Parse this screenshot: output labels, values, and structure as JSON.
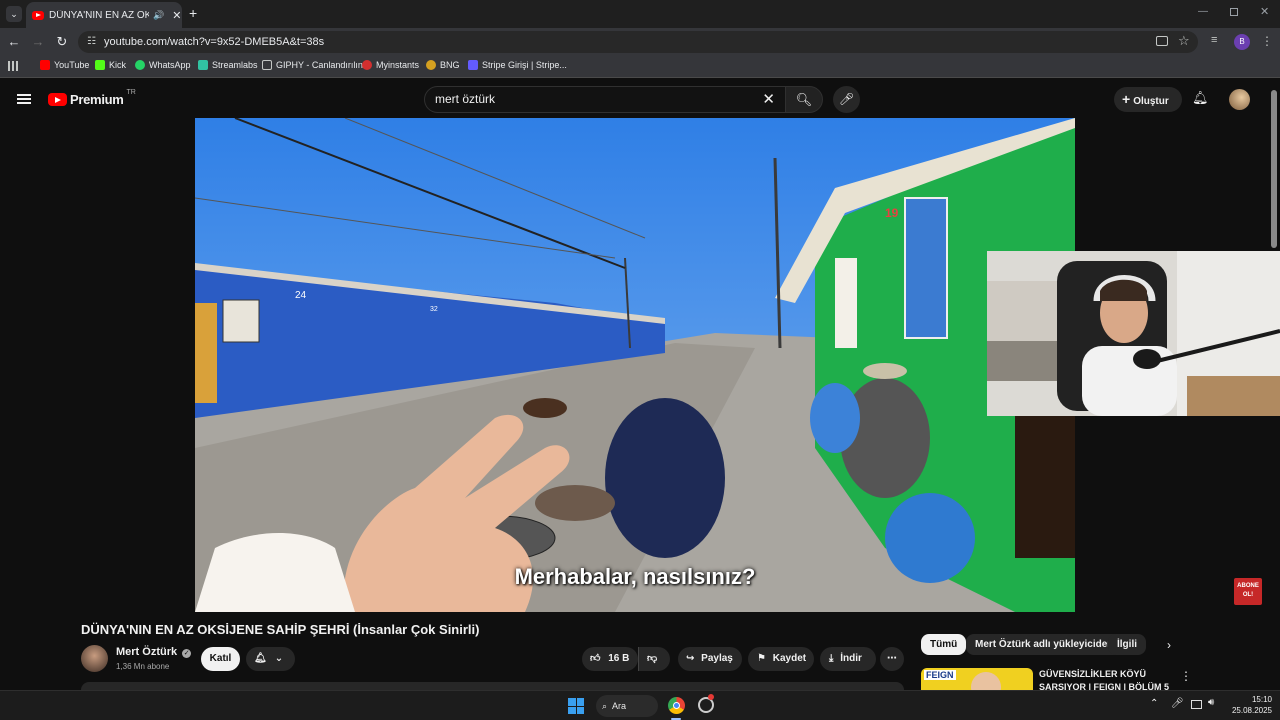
{
  "browser": {
    "tab_title": "DÜNYA'NIN EN AZ OKSİJENE SAHİP ŞEHRİ",
    "url": "youtube.com/watch?v=9x52-DMEB5A&t=38s",
    "bookmarks": [
      {
        "label": "YouTube",
        "color": "#ff0000"
      },
      {
        "label": "Kick",
        "color": "#53fc18"
      },
      {
        "label": "WhatsApp",
        "color": "#25d366"
      },
      {
        "label": "Streamlabs",
        "color": "#31c3a2"
      },
      {
        "label": "GIPHY - Canlandırılın",
        "color": "#ffffff"
      },
      {
        "label": "Myinstants",
        "color": "#d32f2f"
      },
      {
        "label": "BNG",
        "color": "#d4a020"
      },
      {
        "label": "Stripe Girişi | Stripe...",
        "color": "#635bff"
      }
    ],
    "profile_initial": "B"
  },
  "youtube": {
    "logo_text": "Premium",
    "region": "TR",
    "search_value": "mert öztürk",
    "create_label": "Oluştur"
  },
  "video": {
    "subtitle": "Merhabalar, nasılsınız?",
    "sign_text": "24",
    "sign_number_2": "32",
    "sign_number_3": "19",
    "abone_line1": "ABONE",
    "abone_line2": "OL!"
  },
  "meta": {
    "title": "DÜNYA'NIN EN AZ OKSİJENE SAHİP ŞEHRİ (İnsanlar Çok Sinirli)",
    "channel": "Mert Öztürk",
    "subscribers": "1,36 Mn abone",
    "join_label": "Katıl",
    "likes": "16 B",
    "share_label": "Paylaş",
    "save_label": "Kaydet",
    "download_label": "İndir"
  },
  "chips": [
    "Tümü",
    "Mert Öztürk adlı yükleyiciden",
    "İlgili"
  ],
  "related": {
    "title_line1": "GÜVENSİZLİKLER KÖYÜ",
    "title_line2": "SARSIYOR | FEIGN | BÖLÜM 5",
    "thumb_text": "FEIGN"
  },
  "taskbar": {
    "search_label": "Ara",
    "time": "15:10",
    "date": "25.08.2025"
  }
}
